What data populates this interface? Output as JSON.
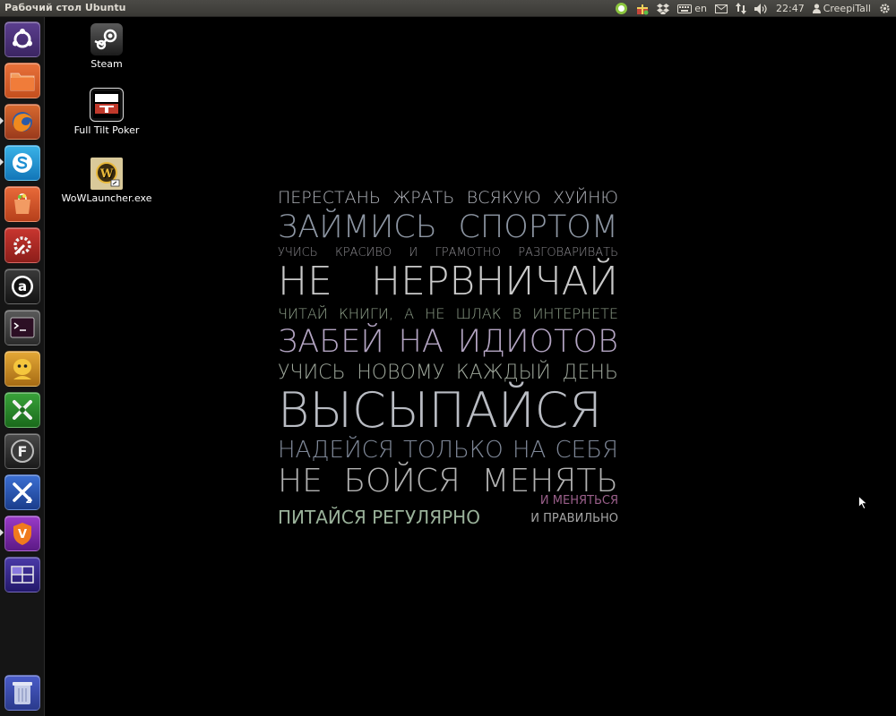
{
  "top_panel": {
    "title": "Рабочий стол Ubuntu",
    "keyboard_layout": "en",
    "clock": "22:47",
    "user": "CreepiTall"
  },
  "launcher": {
    "items": [
      {
        "name": "ubuntu-home"
      },
      {
        "name": "files"
      },
      {
        "name": "firefox"
      },
      {
        "name": "skype"
      },
      {
        "name": "software-center"
      },
      {
        "name": "system-settings"
      },
      {
        "name": "amazon"
      },
      {
        "name": "terminal"
      },
      {
        "name": "pidgin"
      },
      {
        "name": "crossover"
      },
      {
        "name": "f-app"
      },
      {
        "name": "crossover-2"
      },
      {
        "name": "v-app"
      },
      {
        "name": "workspaces"
      },
      {
        "name": "trash"
      }
    ]
  },
  "desktop_icons": [
    {
      "label": "Steam"
    },
    {
      "label": "Full Tilt Poker"
    },
    {
      "label": "WoWLauncher.exe"
    }
  ],
  "wallpaper": {
    "lines": [
      {
        "text": "ПЕРЕСТАНЬ ЖРАТЬ ВСЯКУЮ ХУЙНЮ",
        "color": "#b0b3ba"
      },
      {
        "text": "ЗАЙМИСЬ СПОРТОМ",
        "color": "#8d96a3"
      },
      {
        "text": "УЧИСЬ КРАСИВО И ГРАМОТНО РАЗГОВАРИВАТЬ",
        "color": "#8b8a8f"
      },
      {
        "text": "НЕ НЕРВНИЧАЙ",
        "color": "#c9c9c9"
      },
      {
        "text": "ЧИТАЙ КНИГИ, А НЕ ШЛАК В ИНТЕРНЕТЕ",
        "color": "#8fa08a"
      },
      {
        "text": "ЗАБЕЙ НА ИДИОТОВ",
        "color": "#b3a4c2"
      },
      {
        "text": "УЧИСЬ НОВОМУ КАЖДЫЙ ДЕНЬ",
        "color": "#9da69a"
      },
      {
        "text": "ВЫСЫПАЙСЯ",
        "color": "#b9bcc3"
      },
      {
        "text": "НАДЕЙСЯ ТОЛЬКО НА СЕБЯ",
        "color": "#7f8898"
      },
      {
        "text": "НЕ БОЙСЯ МЕНЯТЬ",
        "color": "#b2b2b2"
      },
      {
        "text": "И МЕНЯТЬСЯ",
        "color": "#9a5f8a"
      },
      {
        "text": "ПИТАЙСЯ РЕГУЛЯРНО",
        "color": "#9ab29a"
      },
      {
        "text": "И ПРАВИЛЬНО",
        "color": "#a5a5a5"
      }
    ]
  }
}
